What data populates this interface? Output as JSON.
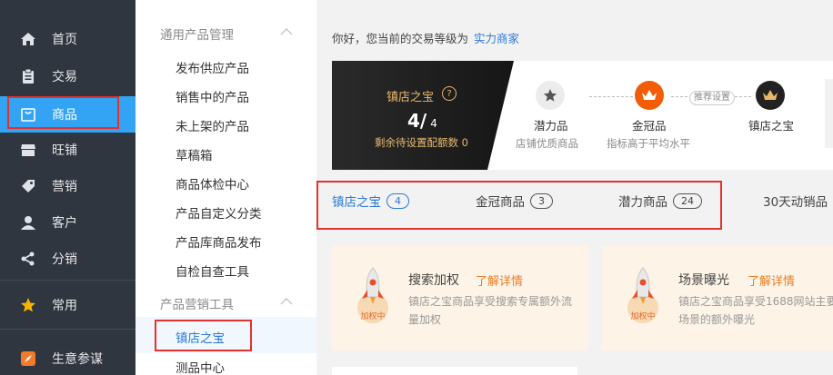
{
  "nav": {
    "items": [
      {
        "label": "首页",
        "icon": "home-icon"
      },
      {
        "label": "交易",
        "icon": "clipboard-icon"
      },
      {
        "label": "商品",
        "icon": "bag-icon"
      },
      {
        "label": "旺铺",
        "icon": "store-icon"
      },
      {
        "label": "营销",
        "icon": "tag-icon"
      },
      {
        "label": "客户",
        "icon": "user-icon"
      },
      {
        "label": "分销",
        "icon": "share-icon"
      },
      {
        "label": "常用",
        "icon": "star-icon"
      },
      {
        "label": "生意参谋",
        "icon": "compass-icon"
      }
    ]
  },
  "submenu": {
    "group1": {
      "title": "通用产品管理",
      "items": [
        "发布供应产品",
        "销售中的产品",
        "未上架的产品",
        "草稿箱",
        "商品体检中心",
        "产品自定义分类",
        "产品库商品发布",
        "自检自查工具"
      ]
    },
    "group2": {
      "title": "产品营销工具",
      "items": [
        "镇店之宝",
        "测品中心"
      ]
    }
  },
  "main": {
    "greeting": "你好，您当前的交易等级为",
    "level": "实力商家",
    "hero": {
      "title": "镇店之宝",
      "help": "?",
      "count": "4/",
      "total": "4",
      "remain": "剩余待设置配额数 0"
    },
    "levels": [
      {
        "name": "潜力品",
        "desc": "店铺优质商品"
      },
      {
        "name": "金冠品",
        "desc": "指标高于平均水平"
      },
      {
        "name": "镇店之宝",
        "desc": ""
      }
    ],
    "recommend": "推荐设置",
    "tabs": [
      {
        "label": "镇店之宝",
        "count": "4"
      },
      {
        "label": "金冠商品",
        "count": "3"
      },
      {
        "label": "潜力商品",
        "count": "24"
      },
      {
        "label": "30天动销品",
        "count": ""
      }
    ],
    "cards": [
      {
        "title": "搜索加权",
        "link": "了解详情",
        "badge": "加权中",
        "desc1": "镇店之宝商品享受搜索专属额外流",
        "desc2": "量加权"
      },
      {
        "title": "场景曝光",
        "link": "了解详情",
        "badge": "加权中",
        "desc1": "镇店之宝商品享受1688网站主要",
        "desc2": "场景的额外曝光"
      }
    ]
  },
  "colors": {
    "nav_bg": "#2f3640",
    "accent": "#33a3f4",
    "link": "#2b7bd6",
    "highlight_box": "#e3322d",
    "gold": "#e8b96a",
    "orange": "#ef7d22"
  }
}
